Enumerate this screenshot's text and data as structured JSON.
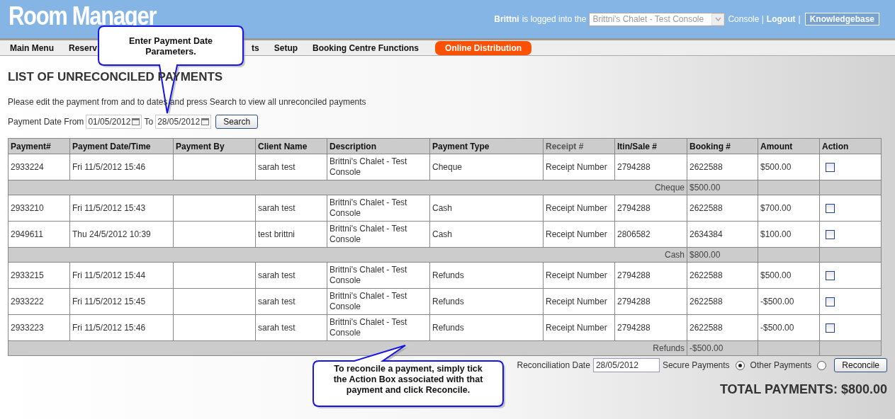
{
  "header": {
    "title": "Room Manager",
    "user": "Brittni",
    "logged_text": "is logged into the",
    "console_select": {
      "value": "Brittni's Chalet - Test Console",
      "disabled": true
    },
    "console_label": "Console |",
    "logout": "Logout",
    "separator": "|",
    "knowledgebase": "Knowledgebase"
  },
  "menu": [
    {
      "label": "Main Menu",
      "kind": "plain"
    },
    {
      "label": "Reserv",
      "kind": "cut"
    },
    {
      "label": "ts",
      "kind": "plain"
    },
    {
      "label": "Setup",
      "kind": "plain"
    },
    {
      "label": "Booking Centre Functions",
      "kind": "plain"
    },
    {
      "label": "Online Distribution",
      "kind": "highlight"
    }
  ],
  "page": {
    "heading": "LIST OF UNRECONCILED PAYMENTS",
    "instructions": "Please edit the payment from and to dates and press Search to view all unreconciled payments",
    "filter": {
      "from_label": "Payment Date From",
      "from_value": "01/05/2012",
      "to_label": "To",
      "to_value": "28/05/2012",
      "search": "Search"
    }
  },
  "table": {
    "columns": [
      {
        "label": "Payment#",
        "muted": false
      },
      {
        "label": "Payment Date/Time",
        "muted": false
      },
      {
        "label": "Payment By",
        "muted": false
      },
      {
        "label": "Client Name",
        "muted": false
      },
      {
        "label": "Description",
        "muted": false
      },
      {
        "label": "Payment Type",
        "muted": false
      },
      {
        "label": "Receipt #",
        "muted": true
      },
      {
        "label": "Itin/Sale #",
        "muted": false
      },
      {
        "label": "Booking #",
        "muted": false
      },
      {
        "label": "Amount",
        "muted": false
      },
      {
        "label": "Action",
        "muted": false
      }
    ],
    "rows": [
      {
        "kind": "payment",
        "cells": [
          "2933224",
          "Fri 11/5/2012 15:46",
          "sarah test",
          "Brittni's Chalet - Test Console",
          "Cheque",
          "Receipt Number",
          "2794288",
          "2622588",
          "$500.00"
        ],
        "checked": false
      },
      {
        "kind": "subtotal",
        "label": "Cheque",
        "amount": "$500.00"
      },
      {
        "kind": "payment",
        "cells": [
          "2933210",
          "Fri 11/5/2012 15:43",
          "sarah test",
          "Brittni's Chalet - Test Console",
          "Cash",
          "Receipt Number",
          "2794288",
          "2622588",
          "$700.00"
        ],
        "checked": false
      },
      {
        "kind": "payment",
        "cells": [
          "2949611",
          "Thu 24/5/2012 10:39",
          "test brittni",
          "Brittni's Chalet - Test Console",
          "Cash",
          "Receipt Number",
          "2806582",
          "2634384",
          "$100.00"
        ],
        "checked": false
      },
      {
        "kind": "subtotal",
        "label": "Cash",
        "amount": "$800.00"
      },
      {
        "kind": "payment",
        "cells": [
          "2933215",
          "Fri 11/5/2012 15:44",
          "sarah test",
          "Brittni's Chalet - Test Console",
          "Refunds",
          "Receipt Number",
          "2794288",
          "2622588",
          "$500.00"
        ],
        "checked": false
      },
      {
        "kind": "payment",
        "cells": [
          "2933222",
          "Fri 11/5/2012 15:45",
          "sarah test",
          "Brittni's Chalet - Test Console",
          "Refunds",
          "Receipt Number",
          "2794288",
          "2622588",
          "-$500.00"
        ],
        "checked": false
      },
      {
        "kind": "payment",
        "cells": [
          "2933223",
          "Fri 11/5/2012 15:46",
          "sarah test",
          "Brittni's Chalet - Test Console",
          "Refunds",
          "Receipt Number",
          "2794288",
          "2622588",
          "-$500.00"
        ],
        "checked": false
      },
      {
        "kind": "subtotal",
        "label": "Refunds",
        "amount": "-$500.00"
      }
    ]
  },
  "reconcile": {
    "date_label": "Reconciliation Date",
    "date_value": "28/05/2012",
    "options": [
      {
        "label": "Secure Payments",
        "selected": true
      },
      {
        "label": "Other Payments",
        "selected": false
      }
    ],
    "button": "Reconcile"
  },
  "total": "TOTAL PAYMENTS: $800.00",
  "callouts": [
    {
      "kind": "date_hint",
      "text": "Enter Payment Date Parameters."
    },
    {
      "kind": "action_hint",
      "text": "To reconcile a payment, simply tick the Action Box associated with that payment and click Reconcile."
    }
  ]
}
